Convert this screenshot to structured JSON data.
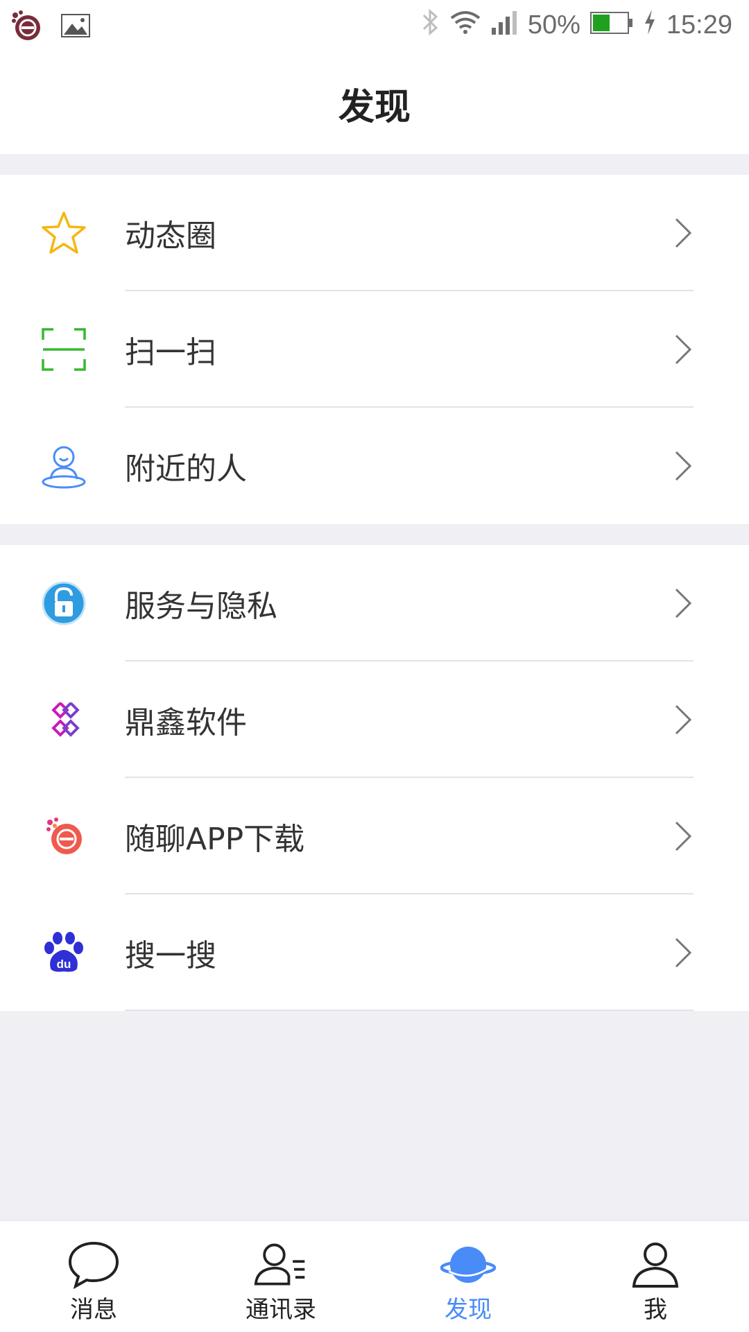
{
  "status_bar": {
    "battery": "50%",
    "time": "15:29",
    "battery_level": 0.5
  },
  "header": {
    "title": "发现"
  },
  "groups": [
    {
      "items": [
        {
          "label": "动态圈",
          "icon": "star-icon"
        },
        {
          "label": "扫一扫",
          "icon": "scan-icon"
        },
        {
          "label": "附近的人",
          "icon": "nearby-person-icon"
        }
      ]
    },
    {
      "items": [
        {
          "label": "服务与隐私",
          "icon": "lock-icon"
        },
        {
          "label": "鼎鑫软件",
          "icon": "dingxin-logo-icon"
        },
        {
          "label": "随聊APP下载",
          "icon": "suiliao-logo-icon"
        },
        {
          "label": "搜一搜",
          "icon": "baidu-paw-icon"
        }
      ]
    }
  ],
  "tabbar": {
    "tabs": [
      {
        "label": "消息",
        "icon": "chat-bubble-icon",
        "active": false
      },
      {
        "label": "通讯录",
        "icon": "contacts-icon",
        "active": false
      },
      {
        "label": "发现",
        "icon": "planet-icon",
        "active": true
      },
      {
        "label": "我",
        "icon": "person-icon",
        "active": false
      }
    ]
  },
  "colors": {
    "accent": "#4a8cf7",
    "background": "#efeff4",
    "battery_fill": "#1fa01f"
  }
}
